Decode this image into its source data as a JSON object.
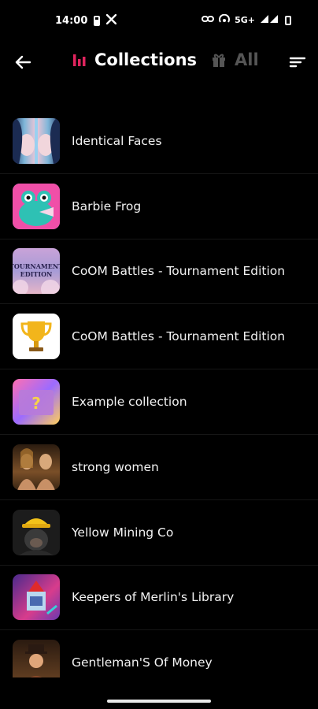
{
  "status_bar": {
    "time": "14:00",
    "network": "5G+"
  },
  "header": {
    "back_icon": "arrow-left-icon",
    "tabs": [
      {
        "label": "Collections",
        "icon": "bar-chart-icon",
        "active": true,
        "color": "#e0245e"
      },
      {
        "label": "All",
        "icon": "gift-icon",
        "active": false,
        "color": "#555555"
      }
    ],
    "sort_icon": "sort-lines-icon"
  },
  "collections": [
    {
      "name": "Identical Faces",
      "thumb": "faces"
    },
    {
      "name": "Barbie Frog",
      "thumb": "frog"
    },
    {
      "name": "CoOM Battles - Tournament Edition",
      "thumb": "tournament-text"
    },
    {
      "name": "CoOM Battles - Tournament Edition",
      "thumb": "trophy"
    },
    {
      "name": "Example collection",
      "thumb": "question-box"
    },
    {
      "name": "strong women",
      "thumb": "women"
    },
    {
      "name": "Yellow Mining Co",
      "thumb": "gorilla-miner"
    },
    {
      "name": "Keepers of Merlin's Library",
      "thumb": "merlin"
    },
    {
      "name": "Gentleman'S Of Money",
      "thumb": "gentleman"
    }
  ],
  "thumb_text": {
    "tournament": "TOURNAMENT EDITION"
  }
}
